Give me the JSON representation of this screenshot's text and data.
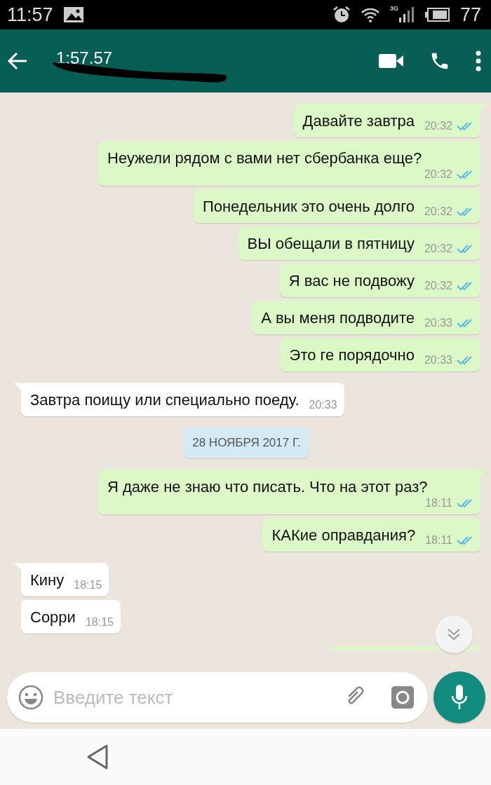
{
  "status_bar": {
    "time": "11:57",
    "network": "3G",
    "battery": "77"
  },
  "header": {
    "title": "1:57.57"
  },
  "messages": [
    {
      "kind": "outgoing",
      "text": "Давайте завтра",
      "time": "20:32",
      "read": true
    },
    {
      "kind": "outgoing",
      "text": "Неужели рядом с вами нет сбербанка еще?",
      "time": "20:32",
      "read": true
    },
    {
      "kind": "outgoing",
      "text": "Понедельник это очень долго",
      "time": "20:32",
      "read": true
    },
    {
      "kind": "outgoing",
      "text": "ВЫ обещали в пятницу",
      "time": "20:32",
      "read": true
    },
    {
      "kind": "outgoing",
      "text": "Я вас не подвожу",
      "time": "20:32",
      "read": true
    },
    {
      "kind": "outgoing",
      "text": "А вы меня подводите",
      "time": "20:33",
      "read": true
    },
    {
      "kind": "outgoing",
      "text": "Это ге порядочно",
      "time": "20:33",
      "read": true
    },
    {
      "kind": "incoming",
      "text": "Завтра поищу или специально поеду.",
      "time": "20:33"
    },
    {
      "kind": "date",
      "text": "28 НОЯБРЯ 2017 Г."
    },
    {
      "kind": "outgoing",
      "text": "Я даже не знаю что писать. Что на этот раз?",
      "time": "18:11",
      "read": true
    },
    {
      "kind": "outgoing",
      "text": "КАКие оправдания?",
      "time": "18:11",
      "read": true
    },
    {
      "kind": "incoming",
      "text": "Кину",
      "time": "18:15"
    },
    {
      "kind": "incoming",
      "text": "Сорри",
      "time": "18:15"
    },
    {
      "kind": "cut_off"
    }
  ],
  "composer": {
    "placeholder": "Введите текст"
  }
}
